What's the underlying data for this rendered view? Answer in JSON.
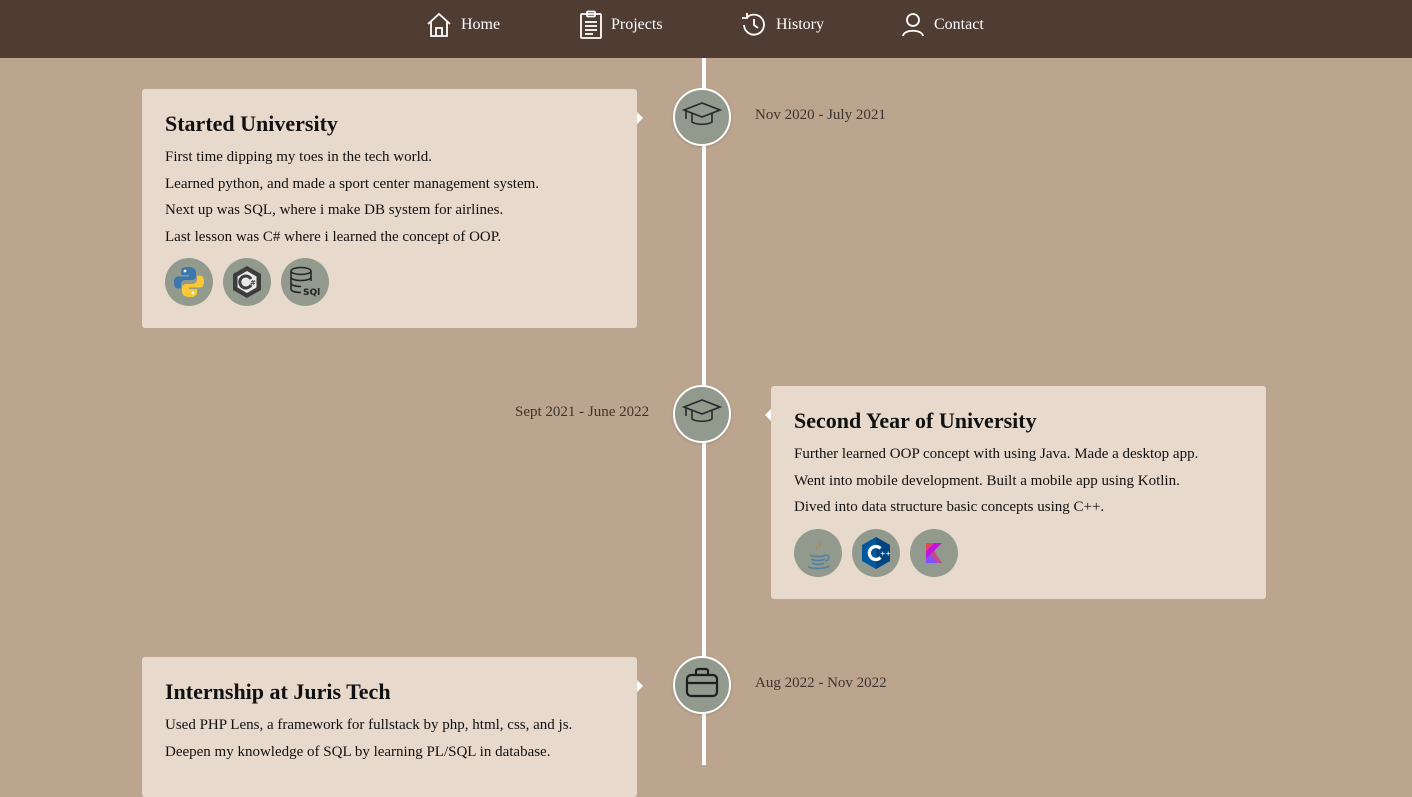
{
  "nav": {
    "items": [
      {
        "label": "Home",
        "icon": "home-icon"
      },
      {
        "label": "Projects",
        "icon": "clipboard-icon"
      },
      {
        "label": "History",
        "icon": "history-icon"
      },
      {
        "label": "Contact",
        "icon": "user-icon"
      }
    ]
  },
  "timeline": [
    {
      "date": "Nov 2020 - July 2021",
      "icon": "graduation-cap-icon",
      "title": "Started University",
      "lines": [
        "First time dipping my toes in the tech world.",
        "Learned python, and made a sport center management system.",
        "Next up was SQL, where i make DB system for airlines.",
        "Last lesson was C# where i learned the concept of OOP."
      ],
      "techs": [
        "python-icon",
        "csharp-icon",
        "sql-icon"
      ]
    },
    {
      "date": "Sept 2021 - June 2022",
      "icon": "graduation-cap-icon",
      "title": "Second Year of University",
      "lines": [
        "Further learned OOP concept with using Java. Made a desktop app.",
        "Went into mobile development. Built a mobile app using Kotlin.",
        "Dived into data structure basic concepts using C++."
      ],
      "techs": [
        "java-icon",
        "cpp-icon",
        "kotlin-icon"
      ]
    },
    {
      "date": "Aug 2022 - Nov 2022",
      "icon": "briefcase-icon",
      "title": "Internship at Juris Tech",
      "lines": [
        "Used PHP Lens, a framework for fullstack by php, html, css, and js.",
        "Deepen my knowledge of SQL by learning PL/SQL in database."
      ]
    }
  ],
  "colors": {
    "background": "#bca58e",
    "nav": "#4f3c32",
    "card": "#e7d9cc",
    "node": "#919a8d"
  }
}
